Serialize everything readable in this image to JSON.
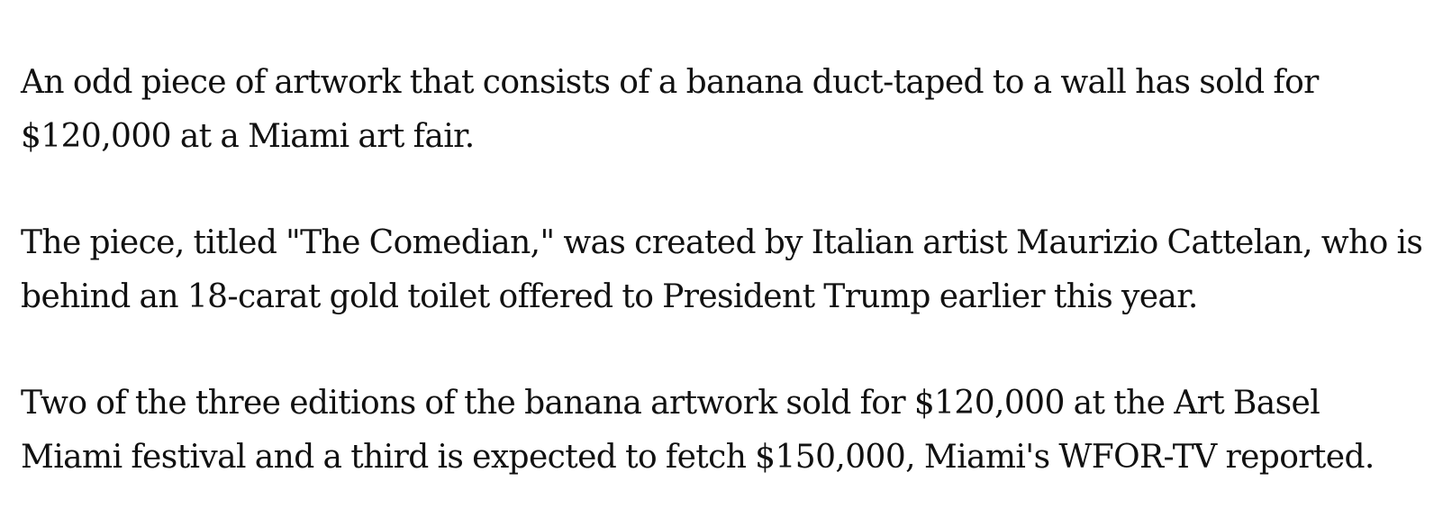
{
  "article": {
    "paragraphs": [
      "An odd piece of artwork that consists of a banana duct-taped to a wall has sold for $120,000 at a Miami art fair.",
      "The piece, titled \"The Comedian,\" was created by Italian artist Maurizio Cattelan, who is behind an 18-carat gold toilet offered to President Trump earlier this year.",
      "Two of the three editions of the banana artwork sold for $120,000 at the Art Basel Miami festival and a third is expected to fetch $150,000, Miami's WFOR-TV reported."
    ]
  },
  "colors": {
    "text": "#111111",
    "background": "#ffffff"
  }
}
